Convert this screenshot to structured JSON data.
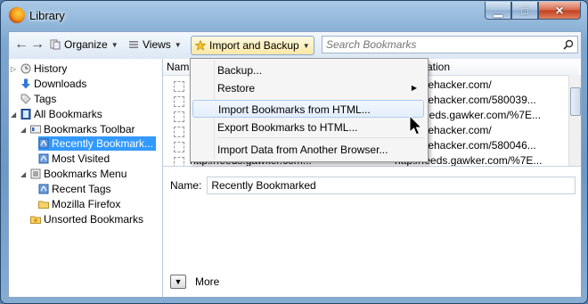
{
  "window": {
    "title": "Library",
    "caption_buttons": {
      "minimize": "▁",
      "maximize": "□",
      "close": "✕"
    }
  },
  "toolbar": {
    "organize": "Organize",
    "views": "Views",
    "import_backup": "Import and Backup",
    "search_placeholder": "Search Bookmarks"
  },
  "sidebar": {
    "items": [
      {
        "label": "History",
        "icon": "clock-icon"
      },
      {
        "label": "Downloads",
        "icon": "download-arrow-icon"
      },
      {
        "label": "Tags",
        "icon": "tag-icon"
      },
      {
        "label": "All Bookmarks",
        "icon": "bookmarks-icon"
      },
      {
        "label": "Bookmarks Toolbar",
        "icon": "toolbar-icon"
      },
      {
        "label": "Recently Bookmark...",
        "icon": "smart-folder-icon"
      },
      {
        "label": "Most Visited",
        "icon": "smart-folder-icon"
      },
      {
        "label": "Bookmarks Menu",
        "icon": "menu-icon"
      },
      {
        "label": "Recent Tags",
        "icon": "smart-folder-icon"
      },
      {
        "label": "Mozilla Firefox",
        "icon": "folder-icon"
      },
      {
        "label": "Unsorted Bookmarks",
        "icon": "folder-star-icon"
      }
    ]
  },
  "list": {
    "headers": {
      "name": "Nam",
      "location": "ation"
    },
    "rows": [
      {
        "location": "//lifehacker.com/"
      },
      {
        "location": "//lifehacker.com/580039..."
      },
      {
        "location": "//feeds.gawker.com/%7E..."
      },
      {
        "location": "//lifehacker.com/"
      },
      {
        "location": "//lifehacker.com/580046..."
      },
      {
        "location": "http://feeds.gawker.com/%7E..."
      }
    ],
    "last_row_name": "http://feeds.gawker.com..."
  },
  "details": {
    "name_label": "Name:",
    "name_value": "Recently Bookmarked",
    "more_label": "More"
  },
  "menu": {
    "items": [
      {
        "label": "Backup...",
        "submenu": false
      },
      {
        "label": "Restore",
        "submenu": true
      },
      {
        "label": "Import Bookmarks from HTML...",
        "submenu": false,
        "highlighted": true
      },
      {
        "label": "Export Bookmarks to HTML...",
        "submenu": false
      },
      {
        "label": "Import Data from Another Browser...",
        "submenu": false
      }
    ]
  },
  "colors": {
    "selection": "#3399ff",
    "window_frame": "#6d98c5"
  }
}
